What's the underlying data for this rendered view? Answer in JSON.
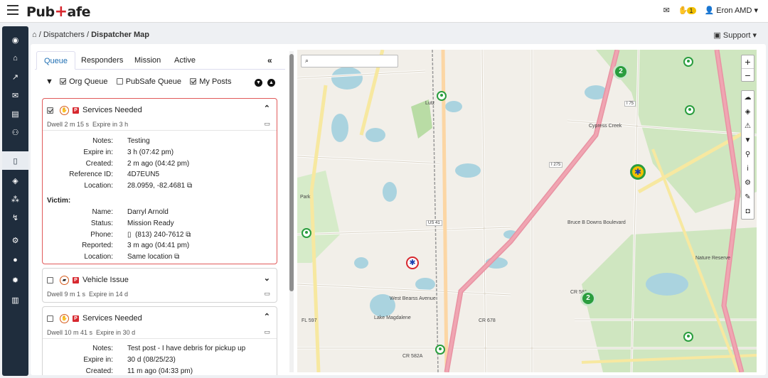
{
  "header": {
    "logo_text_left": "Pub",
    "logo_plus": "+",
    "logo_text_right": "afe",
    "notification_count": "1",
    "user_name": "Eron AMD"
  },
  "breadcrumb": {
    "item1": "Dispatchers",
    "separator": "/",
    "current": "Dispatcher Map"
  },
  "support": "Support",
  "tabs": [
    "Queue",
    "Responders",
    "Mission",
    "Active"
  ],
  "collapse_label": "«",
  "filters": {
    "org_queue": "Org Queue",
    "pubsafe_queue": "PubSafe Queue",
    "my_posts": "My Posts"
  },
  "posts": [
    {
      "title": "Services Needed",
      "dwell": "Dwell 2 m 15 s",
      "expire_short": "Expire in 3 h",
      "fields": [
        {
          "k": "Notes:",
          "v": "Testing"
        },
        {
          "k": "Expire in:",
          "v": "3 h (07:42 pm)"
        },
        {
          "k": "Created:",
          "v": "2 m ago (04:42 pm)"
        },
        {
          "k": "Reference ID:",
          "v": "4D7EUN5"
        },
        {
          "k": "Location:",
          "v": "28.0959, -82.4681"
        }
      ],
      "victim_heading": "Victim:",
      "victim": [
        {
          "k": "Name:",
          "v": "Darryl Arnold"
        },
        {
          "k": "Status:",
          "v": "Mission Ready"
        },
        {
          "k": "Phone:",
          "v": "(813) 240-7612"
        },
        {
          "k": "Reported:",
          "v": "3 m ago (04:41 pm)"
        },
        {
          "k": "Location:",
          "v": "Same location"
        }
      ]
    },
    {
      "title": "Vehicle Issue",
      "dwell": "Dwell 9 m 1 s",
      "expire_short": "Expire in 14 d"
    },
    {
      "title": "Services Needed",
      "dwell": "Dwell 10 m 41 s",
      "expire_short": "Expire in 30 d",
      "fields": [
        {
          "k": "Notes:",
          "v": "Test post - I have debris for pickup up"
        },
        {
          "k": "Expire in:",
          "v": "30 d (08/25/23)"
        },
        {
          "k": "Created:",
          "v": "11 m ago (04:33 pm)"
        }
      ]
    }
  ],
  "map": {
    "labels": [
      "Lutz",
      "Cypress Creek",
      "I 275",
      "I 75",
      "US 41",
      "CR 582A",
      "CR 678",
      "FL 597",
      "CR 581",
      "Lake Magdalene",
      "West Bearss Avenue",
      "Bruce B Downs Boulevard",
      "Nature Reserve",
      "Park"
    ],
    "clusters": [
      "2",
      "2"
    ],
    "zoom_in": "+",
    "zoom_out": "−"
  },
  "colors": {
    "accent": "#1f6fb3",
    "sidebar": "#1f2d3d",
    "marker": "#2a9d3e",
    "alert": "#d7282f"
  }
}
